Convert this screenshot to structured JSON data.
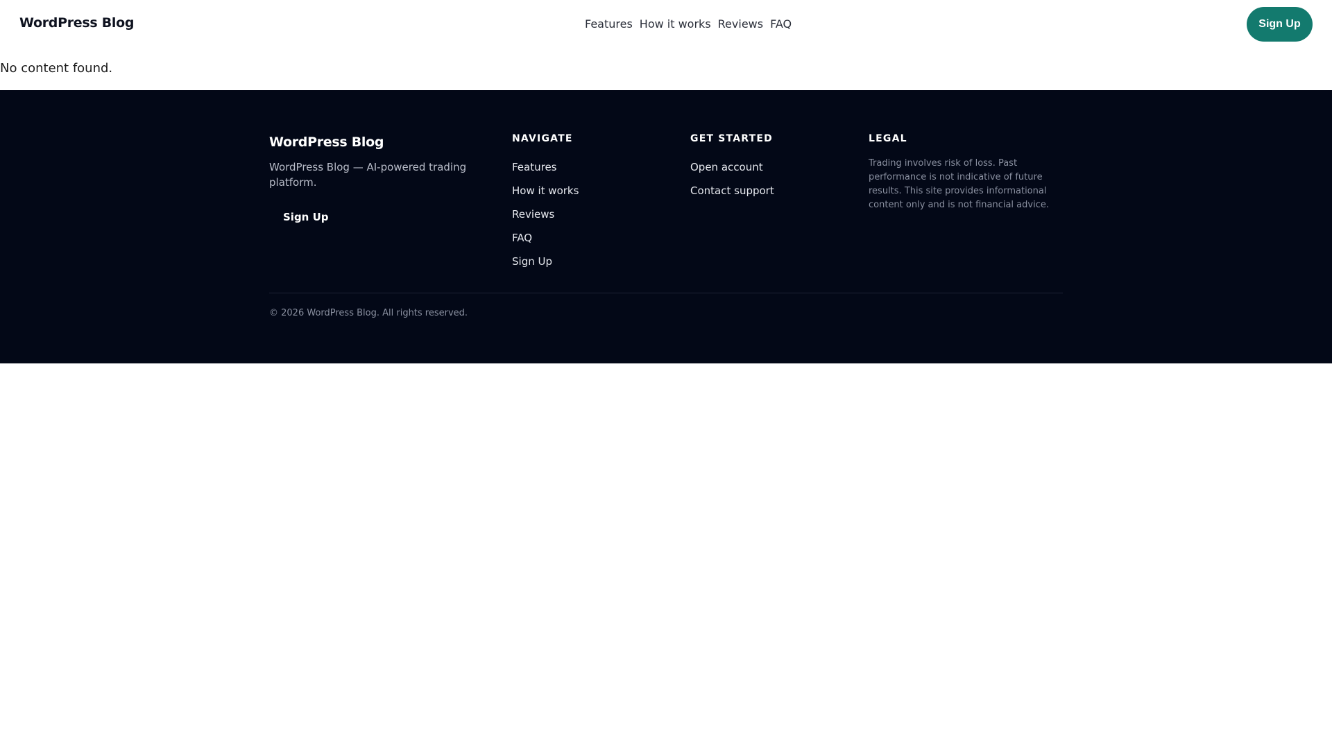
{
  "header": {
    "brand": "WordPress Blog",
    "nav": [
      "Features",
      "How it works",
      "Reviews",
      "FAQ"
    ],
    "cta_label": "Sign Up"
  },
  "main": {
    "message": "No content found."
  },
  "footer": {
    "brand": "WordPress Blog",
    "tagline": "WordPress Blog — AI-powered trading platform.",
    "signup_label": "Sign Up",
    "navigate": {
      "heading": "NAVIGATE",
      "links": [
        "Features",
        "How it works",
        "Reviews",
        "FAQ",
        "Sign Up"
      ]
    },
    "get_started": {
      "heading": "GET STARTED",
      "links": [
        "Open account",
        "Contact support"
      ]
    },
    "legal": {
      "heading": "LEGAL",
      "text": "Trading involves risk of loss. Past performance is not indicative of future results. This site provides informational content only and is not financial advice."
    },
    "copyright": "© 2026 WordPress Blog. All rights reserved."
  },
  "colors": {
    "accent": "#137a6e",
    "footer_bg": "#030817"
  }
}
